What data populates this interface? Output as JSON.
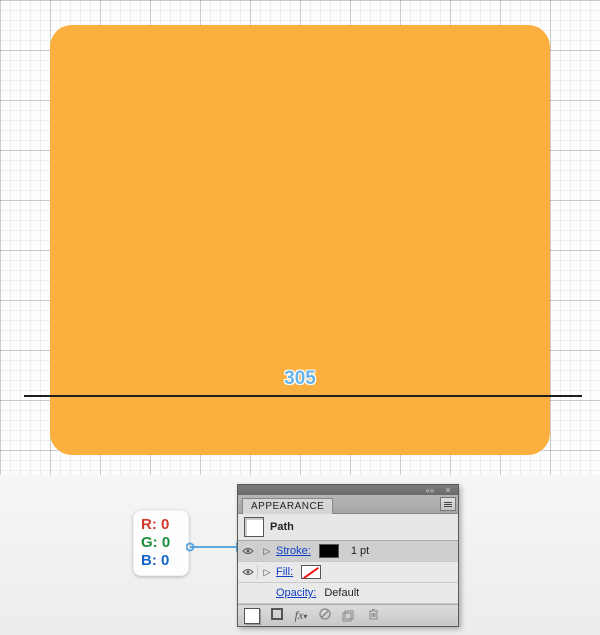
{
  "canvas": {
    "line_length_label": "305"
  },
  "rgb_callout": {
    "r": "R: 0",
    "g": "G: 0",
    "b": "B: 0"
  },
  "panel": {
    "title": "APPEARANCE",
    "target": "Path",
    "rows": {
      "stroke": {
        "label": "Stroke:",
        "value": "1 pt"
      },
      "fill": {
        "label": "Fill:"
      },
      "opacity": {
        "label": "Opacity:",
        "value": "Default"
      }
    }
  }
}
